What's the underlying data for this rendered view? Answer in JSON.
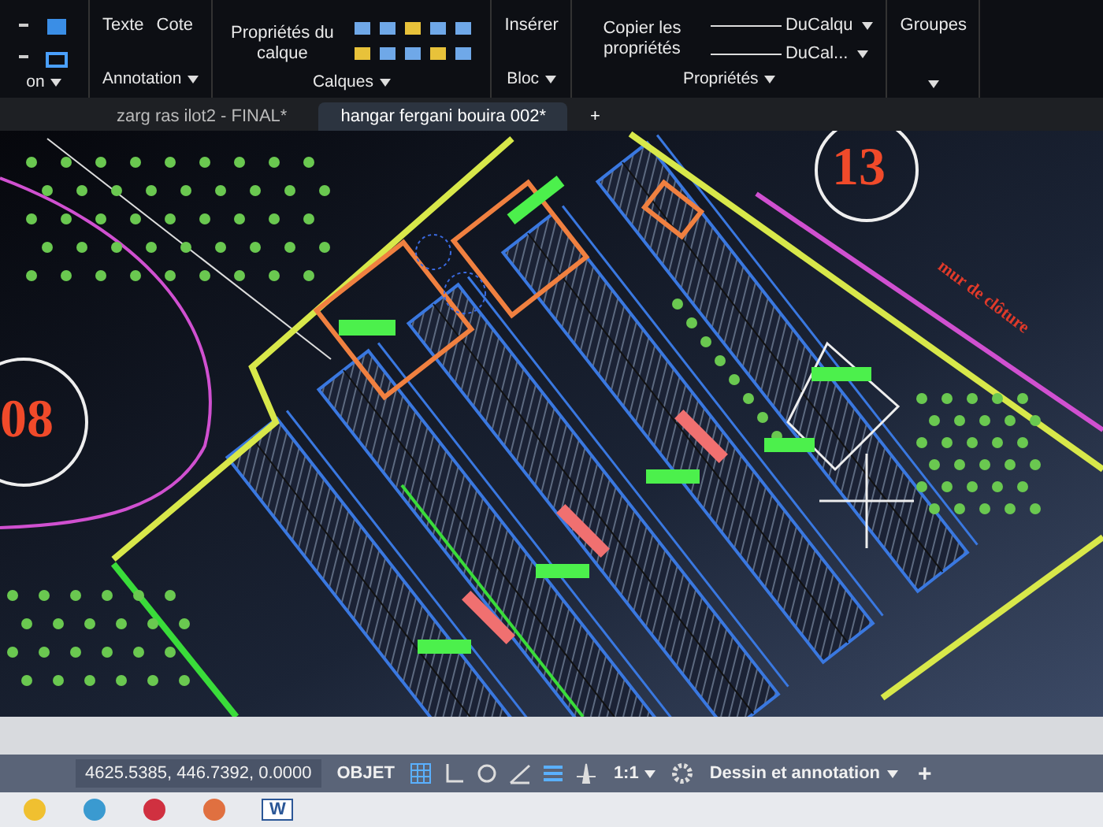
{
  "ribbon": {
    "panels": [
      {
        "title": "on"
      },
      {
        "title": "Annotation",
        "tools": [
          "Texte",
          "Cote"
        ]
      },
      {
        "title": "Calques",
        "tools": [
          "Propriétés du calque"
        ]
      },
      {
        "title": "Bloc",
        "tools": [
          "Insérer"
        ]
      },
      {
        "title": "Propriétés",
        "tools": [
          "Copier les propriétés"
        ],
        "dropdowns": [
          "DuCalqu",
          "DuCal..."
        ]
      },
      {
        "tools": [
          "Groupes"
        ]
      }
    ]
  },
  "tabs": [
    {
      "label": "zarg ras ilot2 - FINAL*",
      "selected": false
    },
    {
      "label": "hangar fergani bouira 002*",
      "selected": true
    }
  ],
  "new_tab": "+",
  "drawing": {
    "plot_numbers": [
      "13",
      "08"
    ],
    "note": "mur de clôture"
  },
  "status_bar": {
    "coordinates": "4625.5385, 446.7392, 0.0000",
    "mode": "OBJET",
    "scale": "1:1",
    "workspace": "Dessin et annotation",
    "add": "+"
  },
  "taskbar": {
    "word_letter": "W"
  }
}
